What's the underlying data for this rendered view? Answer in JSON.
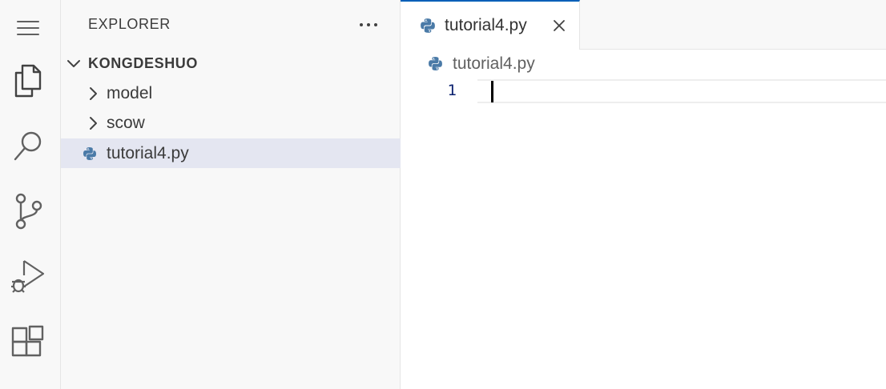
{
  "activity_bar": {
    "items": [
      {
        "name": "menu-icon"
      },
      {
        "name": "explorer-icon"
      },
      {
        "name": "search-icon"
      },
      {
        "name": "source-control-icon"
      },
      {
        "name": "run-debug-icon"
      },
      {
        "name": "extensions-icon"
      }
    ]
  },
  "sidebar": {
    "title": "EXPLORER",
    "more_icon": "ellipsis-icon",
    "root_folder": "KONGDESHUO",
    "items": [
      {
        "label": "model",
        "type": "folder",
        "expanded": false
      },
      {
        "label": "scow",
        "type": "folder",
        "expanded": false
      },
      {
        "label": "tutorial4.py",
        "type": "python-file",
        "selected": true
      }
    ]
  },
  "editor": {
    "tabs": [
      {
        "label": "tutorial4.py",
        "icon": "python-file-icon",
        "active": true
      }
    ],
    "breadcrumb": {
      "label": "tutorial4.py",
      "icon": "python-file-icon"
    },
    "lines": [
      {
        "number": "1",
        "text": ""
      }
    ]
  },
  "colors": {
    "accent": "#005fb8",
    "python_icon": "#4a7aa7",
    "selection": "#e4e6f1",
    "line_number": "#0b216f"
  }
}
